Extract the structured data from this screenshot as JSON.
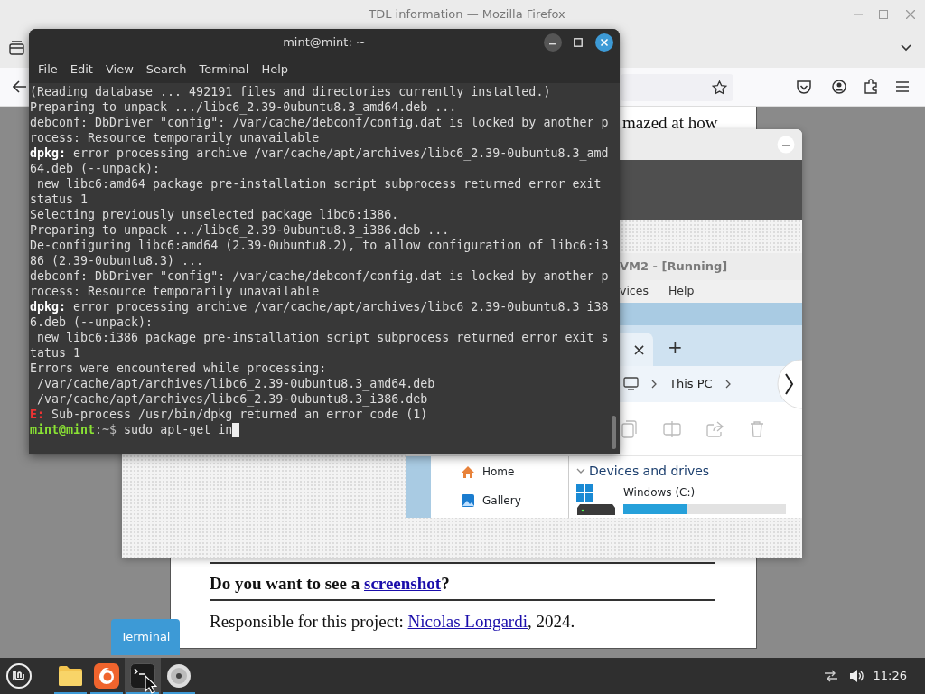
{
  "firefox": {
    "title": "TDL information — Mozilla Firefox",
    "page": {
      "fragment": "mazed at how",
      "question": {
        "before": "Do you want to see a ",
        "link": "screenshot",
        "after": "?"
      },
      "credit": {
        "before": "Responsible for this project: ",
        "link": "Nicolas Longardi",
        "after": ", 2024."
      }
    }
  },
  "viewer": {
    "vm_title": "VM2 - [Running]",
    "vm_menu": [
      "vices",
      "Help"
    ],
    "explorer": {
      "tab_close": "×",
      "new_tab": "+",
      "breadcrumb": "This PC",
      "nav_items": [
        {
          "label": "Home",
          "kind": "home"
        },
        {
          "label": "Gallery",
          "kind": "gallery"
        }
      ],
      "section": "Devices and drives",
      "drive": {
        "label": "Windows (C:)",
        "level": 0.39
      }
    }
  },
  "terminal": {
    "title": "mint@mint: ~",
    "menu": [
      "File",
      "Edit",
      "View",
      "Search",
      "Terminal",
      "Help"
    ],
    "lines": [
      {
        "kind": "output",
        "text": "(Reading database ... 492191 files and directories currently installed.)"
      },
      {
        "kind": "output",
        "text": "Preparing to unpack .../libc6_2.39-0ubuntu8.3_amd64.deb ..."
      },
      {
        "kind": "output",
        "text": "debconf: DbDriver \"config\": /var/cache/debconf/config.dat is locked by another p"
      },
      {
        "kind": "output",
        "text": "rocess: Resource temporarily unavailable"
      },
      {
        "kind": "output",
        "text": "**dpkg:** error processing archive /var/cache/apt/archives/libc6_2.39-0ubuntu8.3_amd"
      },
      {
        "kind": "output",
        "text": "64.deb (--unpack):"
      },
      {
        "kind": "output",
        "text": " new libc6:amd64 package pre-installation script subprocess returned error exit"
      },
      {
        "kind": "output",
        "text": "status 1"
      },
      {
        "kind": "output",
        "text": "Selecting previously unselected package libc6:i386."
      },
      {
        "kind": "output",
        "text": "Preparing to unpack .../libc6_2.39-0ubuntu8.3_i386.deb ..."
      },
      {
        "kind": "output",
        "text": "De-configuring libc6:amd64 (2.39-0ubuntu8.2), to allow configuration of libc6:i3"
      },
      {
        "kind": "output",
        "text": "86 (2.39-0ubuntu8.3) ..."
      },
      {
        "kind": "output",
        "text": "debconf: DbDriver \"config\": /var/cache/debconf/config.dat is locked by another p"
      },
      {
        "kind": "output",
        "text": "rocess: Resource temporarily unavailable"
      },
      {
        "kind": "output",
        "text": "**dpkg:** error processing archive /var/cache/apt/archives/libc6_2.39-0ubuntu8.3_i38"
      },
      {
        "kind": "output",
        "text": "6.deb (--unpack):"
      },
      {
        "kind": "output",
        "text": " new libc6:i386 package pre-installation script subprocess returned error exit s"
      },
      {
        "kind": "output",
        "text": "tatus 1"
      },
      {
        "kind": "output",
        "text": "Errors were encountered while processing:"
      },
      {
        "kind": "output",
        "text": " /var/cache/apt/archives/libc6_2.39-0ubuntu8.3_amd64.deb"
      },
      {
        "kind": "output",
        "text": " /var/cache/apt/archives/libc6_2.39-0ubuntu8.3_i386.deb"
      },
      {
        "kind": "error",
        "label": "E:",
        "text": " Sub-process /usr/bin/dpkg returned an error code (1)"
      }
    ],
    "prompt": {
      "user": "mint@mint",
      "path": ":~$",
      "command": "sudo apt-get in"
    }
  },
  "taskbar": {
    "apps": [
      {
        "kind": "files",
        "running": true,
        "active": false
      },
      {
        "kind": "firefox",
        "running": true,
        "active": false
      },
      {
        "kind": "terminal",
        "running": true,
        "active": true
      },
      {
        "kind": "disc",
        "running": true,
        "active": false
      }
    ],
    "clock": "11:26",
    "tooltip": "Terminal"
  }
}
